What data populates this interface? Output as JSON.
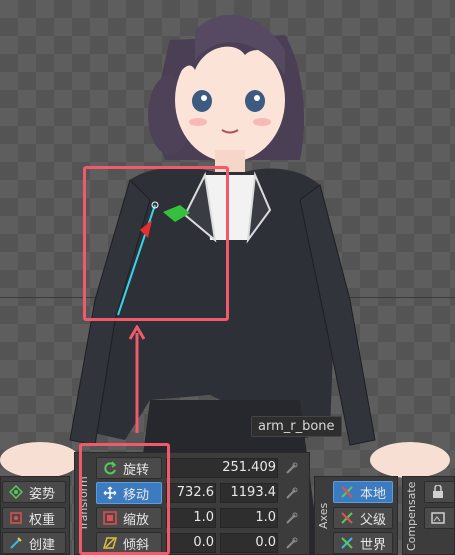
{
  "viewport": {
    "bone_label": "arm_r_bone"
  },
  "left_panel": {
    "items": [
      {
        "label": "姿势",
        "icon": "pose-icon"
      },
      {
        "label": "权重",
        "icon": "weight-icon"
      },
      {
        "label": "创建",
        "icon": "create-icon"
      }
    ]
  },
  "transform": {
    "section_label": "Transform",
    "rows": [
      {
        "label": "旋转",
        "icon": "rotate-icon",
        "values": [
          "251.409"
        ]
      },
      {
        "label": "移动",
        "icon": "move-icon",
        "values": [
          "732.6",
          "1193.4"
        ],
        "active": true
      },
      {
        "label": "缩放",
        "icon": "scale-icon",
        "values": [
          "1.0",
          "1.0"
        ]
      },
      {
        "label": "倾斜",
        "icon": "skew-icon",
        "values": [
          "0.0",
          "0.0"
        ]
      }
    ]
  },
  "axes": {
    "section_label": "Axes",
    "items": [
      {
        "label": "本地",
        "icon": "local-icon",
        "active": true
      },
      {
        "label": "父级",
        "icon": "parent-icon"
      },
      {
        "label": "世界",
        "icon": "world-icon"
      }
    ]
  },
  "compensate": {
    "section_label": "Compensate"
  },
  "colors": {
    "highlight": "#f05a6a",
    "active_button": "#3c7bbf"
  }
}
